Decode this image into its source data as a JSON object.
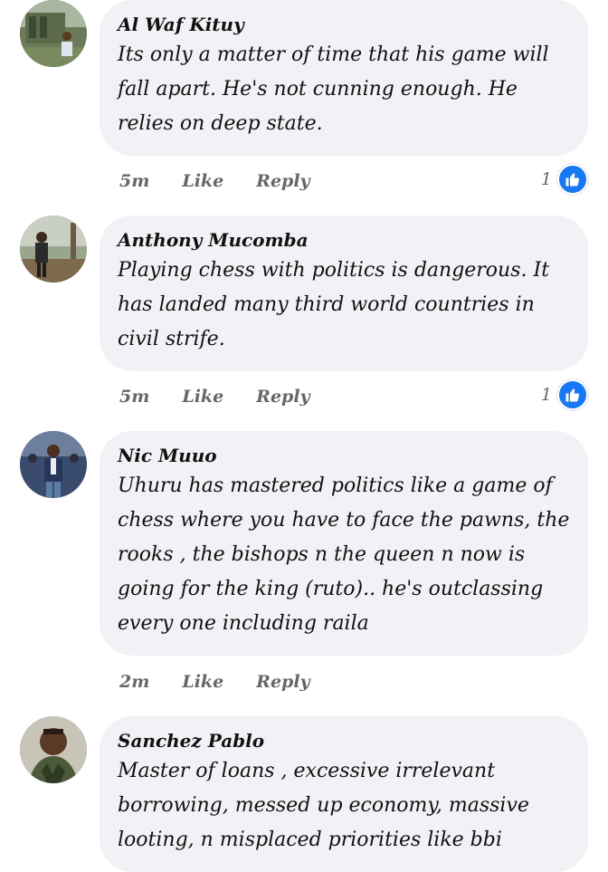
{
  "comments": [
    {
      "author": "Al Waf Kituy",
      "text": "Its only a matter of time that his game will fall apart. He's not cunning enough. He relies on deep state.",
      "time": "5m",
      "like_label": "Like",
      "reply_label": "Reply",
      "reaction_count": "1",
      "reaction_icon": "thumbs-up-icon"
    },
    {
      "author": "Anthony Mucomba",
      "text": "Playing chess with politics is dangerous. It has landed many third world countries in civil strife.",
      "time": "5m",
      "like_label": "Like",
      "reply_label": "Reply",
      "reaction_count": "1",
      "reaction_icon": "thumbs-up-icon"
    },
    {
      "author": "Nic Muuo",
      "text": "Uhuru has mastered politics like a game of chess where you have to face the pawns, the rooks , the bishops n the queen n now is going for the king (ruto).. he's outclassing every one including raila",
      "time": "2m",
      "like_label": "Like",
      "reply_label": "Reply"
    },
    {
      "author": "Sanchez Pablo",
      "text": "Master of loans , excessive irrelevant borrowing, messed up economy, massive looting, n misplaced priorities like bbi"
    }
  ],
  "colors": {
    "bubble_bg": "#f0f2f5",
    "meta_text": "#65676b",
    "like_blue": "#1877f2"
  }
}
